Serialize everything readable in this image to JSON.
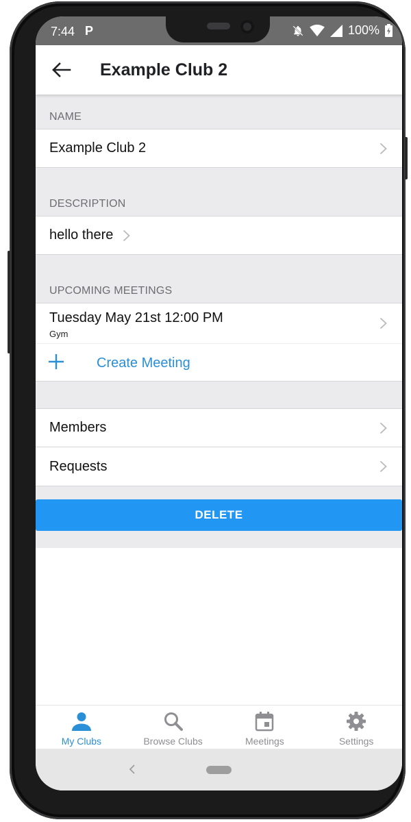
{
  "status_bar": {
    "time": "7:44",
    "carrier_icon": "P",
    "battery": "100%"
  },
  "app_bar": {
    "title": "Example Club 2",
    "back_icon": "arrow-left-icon"
  },
  "sections": {
    "name": {
      "header": "NAME",
      "value": "Example Club 2"
    },
    "description": {
      "header": "DESCRIPTION",
      "value": "hello there"
    },
    "upcoming_meetings": {
      "header": "UPCOMING MEETINGS",
      "meetings": [
        {
          "title": "Tuesday May 21st 12:00 PM",
          "location": "Gym"
        }
      ],
      "create_label": "Create Meeting"
    }
  },
  "links": [
    {
      "label": "Members"
    },
    {
      "label": "Requests"
    }
  ],
  "delete_label": "DELETE",
  "tabs": [
    {
      "label": "My Clubs",
      "icon": "person-icon",
      "active": true
    },
    {
      "label": "Browse Clubs",
      "icon": "search-icon",
      "active": false
    },
    {
      "label": "Meetings",
      "icon": "calendar-icon",
      "active": false
    },
    {
      "label": "Settings",
      "icon": "gear-icon",
      "active": false
    }
  ],
  "colors": {
    "accent": "#2196f3",
    "link_text": "#2a8fd6",
    "inactive_tab": "#8e8e93",
    "section_bg": "#ebebed"
  }
}
